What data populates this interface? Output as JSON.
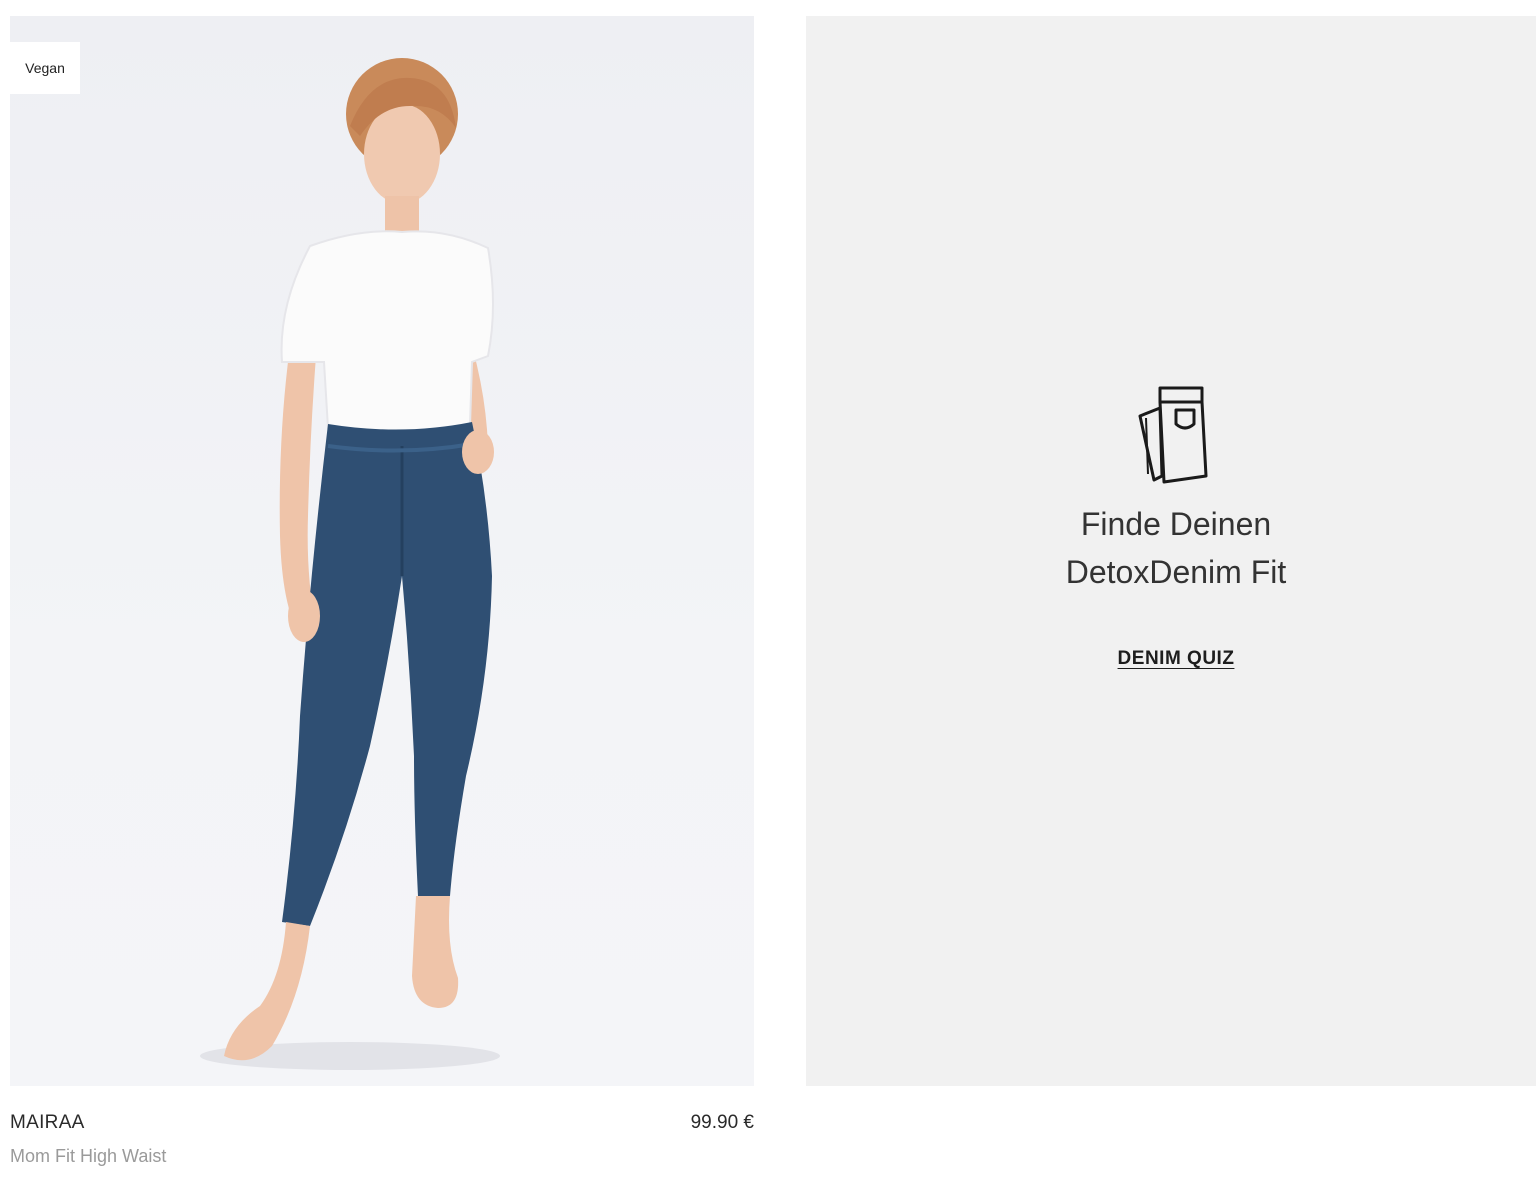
{
  "product": {
    "badge": "Vegan",
    "name": "MAIRAA",
    "subtitle": "Mom Fit High Waist",
    "price": "99.90 €",
    "image_icon": "model-photo"
  },
  "quiz": {
    "icon": "jeans-icon",
    "heading_line1": "Finde Deinen",
    "heading_line2": "DetoxDenim Fit",
    "link_label": "DENIM QUIZ"
  },
  "colors": {
    "quiz_background": "#f1f1f1",
    "denim": "#2f4f73",
    "text_muted": "#9a9a9a"
  }
}
